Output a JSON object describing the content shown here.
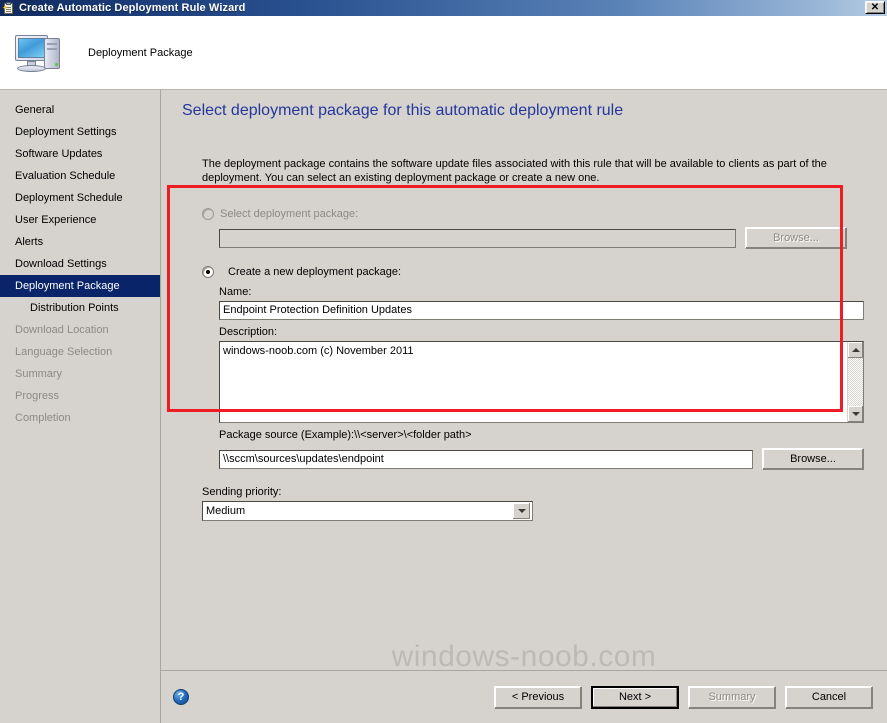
{
  "window": {
    "title": "Create Automatic Deployment Rule Wizard",
    "title_icon": "wizard-clipboard-icon",
    "close_label": "✕"
  },
  "header": {
    "icon": "computer-icon",
    "title": "Deployment Package"
  },
  "sidebar": {
    "items": [
      {
        "label": "General",
        "state": "normal",
        "sub": false
      },
      {
        "label": "Deployment Settings",
        "state": "normal",
        "sub": false
      },
      {
        "label": "Software Updates",
        "state": "normal",
        "sub": false
      },
      {
        "label": "Evaluation Schedule",
        "state": "normal",
        "sub": false
      },
      {
        "label": "Deployment Schedule",
        "state": "normal",
        "sub": false
      },
      {
        "label": "User Experience",
        "state": "normal",
        "sub": false
      },
      {
        "label": "Alerts",
        "state": "normal",
        "sub": false
      },
      {
        "label": "Download Settings",
        "state": "normal",
        "sub": false
      },
      {
        "label": "Deployment Package",
        "state": "selected",
        "sub": false
      },
      {
        "label": "Distribution Points",
        "state": "normal",
        "sub": true
      },
      {
        "label": "Download Location",
        "state": "disabled",
        "sub": false
      },
      {
        "label": "Language Selection",
        "state": "disabled",
        "sub": false
      },
      {
        "label": "Summary",
        "state": "disabled",
        "sub": false
      },
      {
        "label": "Progress",
        "state": "disabled",
        "sub": false
      },
      {
        "label": "Completion",
        "state": "disabled",
        "sub": false
      }
    ]
  },
  "main": {
    "heading": "Select deployment package for this automatic deployment rule",
    "description": "The deployment package contains the software update files associated with this rule that will be available to clients as part of the deployment. You can select an existing deployment package or create a new one.",
    "select_package": {
      "radio_label": "Select deployment package:",
      "radio_selected": false,
      "enabled": false,
      "value": "",
      "browse_label": "Browse..."
    },
    "create_package": {
      "radio_label": "Create a new deployment package:",
      "radio_selected": true,
      "name_label": "Name:",
      "name_value": "Endpoint Protection Definition Updates",
      "description_label": "Description:",
      "description_value": "windows-noob.com (c) November 2011",
      "package_source_label": "Package source (Example):\\\\<server>\\<folder path>",
      "package_source_value": "\\\\sccm\\sources\\updates\\endpoint",
      "browse_label": "Browse..."
    },
    "sending_priority": {
      "label": "Sending priority:",
      "value": "Medium"
    },
    "highlight_color": "#ef1c24"
  },
  "watermark": "windows-noob.com",
  "footer": {
    "help_label": "?",
    "previous_label": "< Previous",
    "next_label": "Next >",
    "summary_label": "Summary",
    "cancel_label": "Cancel"
  }
}
